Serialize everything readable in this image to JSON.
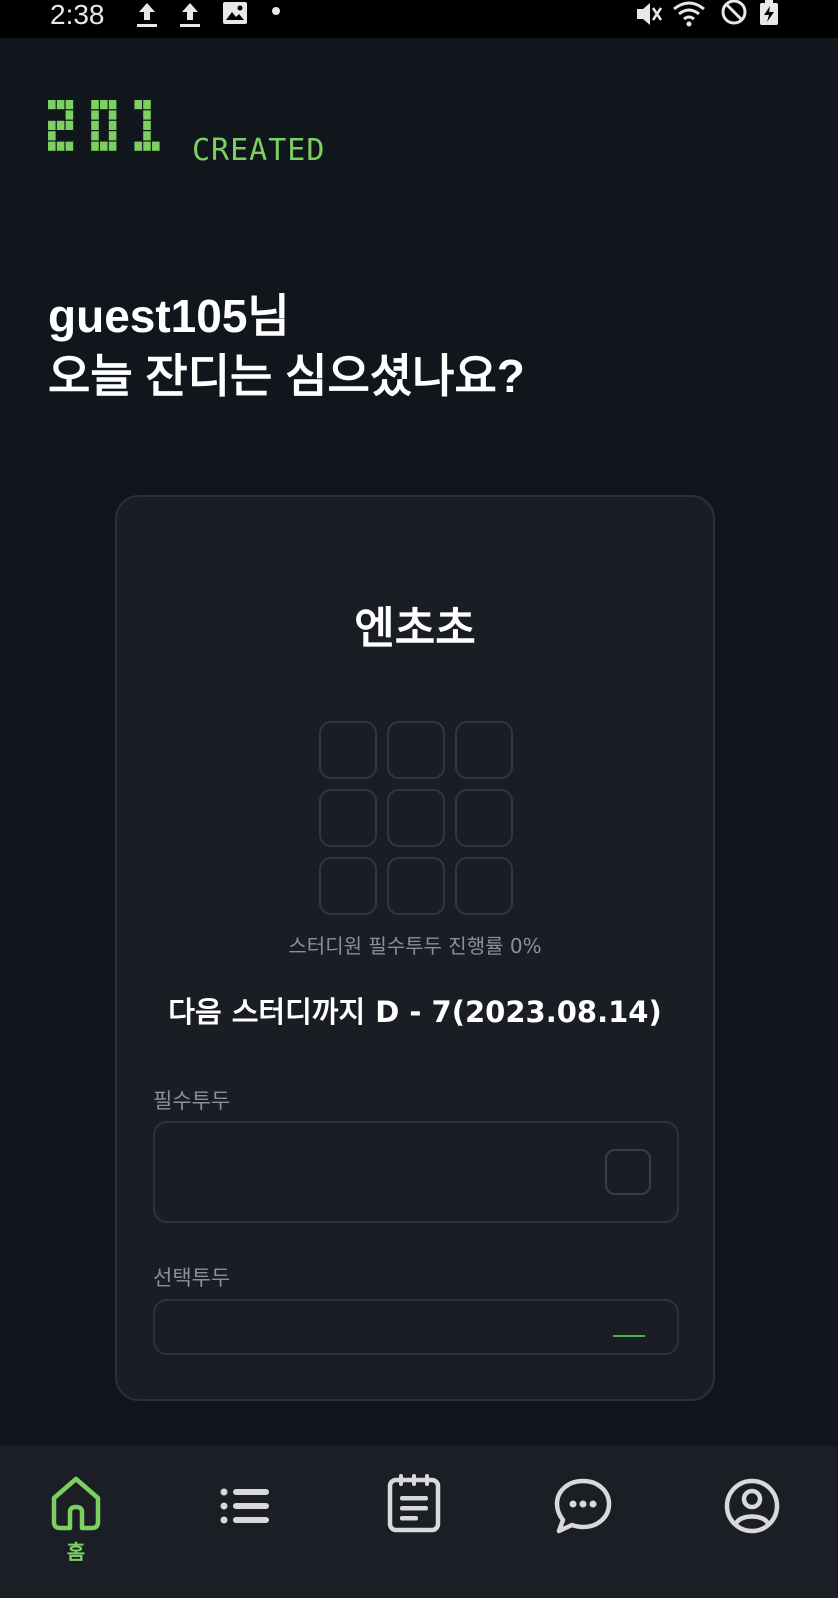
{
  "status_bar": {
    "time": "2:38",
    "icons": [
      "upload-icon",
      "upload-icon",
      "image-icon",
      "dot-icon",
      "mute-icon",
      "wifi-icon",
      "dnd-icon",
      "battery-charging-icon"
    ]
  },
  "logo": {
    "number": "201",
    "word": "CREATED"
  },
  "greeting": {
    "line1": "guest105님",
    "line2": "오늘 잔디는 심으셨나요?"
  },
  "card": {
    "title": "엔초초",
    "grid_cells": 9,
    "progress_text": "스터디원 필수투두 진행률 0%",
    "dday_text": "다음 스터디까지 D - 7(2023.08.14)",
    "required_label": "필수투두",
    "optional_label": "선택투두"
  },
  "navbar": {
    "items": [
      {
        "icon": "home-icon",
        "label": "홈",
        "active": true
      },
      {
        "icon": "list-icon",
        "label": "",
        "active": false
      },
      {
        "icon": "notepad-icon",
        "label": "",
        "active": false
      },
      {
        "icon": "chat-icon",
        "label": "",
        "active": false
      },
      {
        "icon": "profile-icon",
        "label": "",
        "active": false
      }
    ]
  },
  "colors": {
    "accent": "#7cd060",
    "background": "#11151c",
    "card": "#1a1d24",
    "navbar": "#1b1e25",
    "icon_inactive": "#d9d9d9"
  }
}
